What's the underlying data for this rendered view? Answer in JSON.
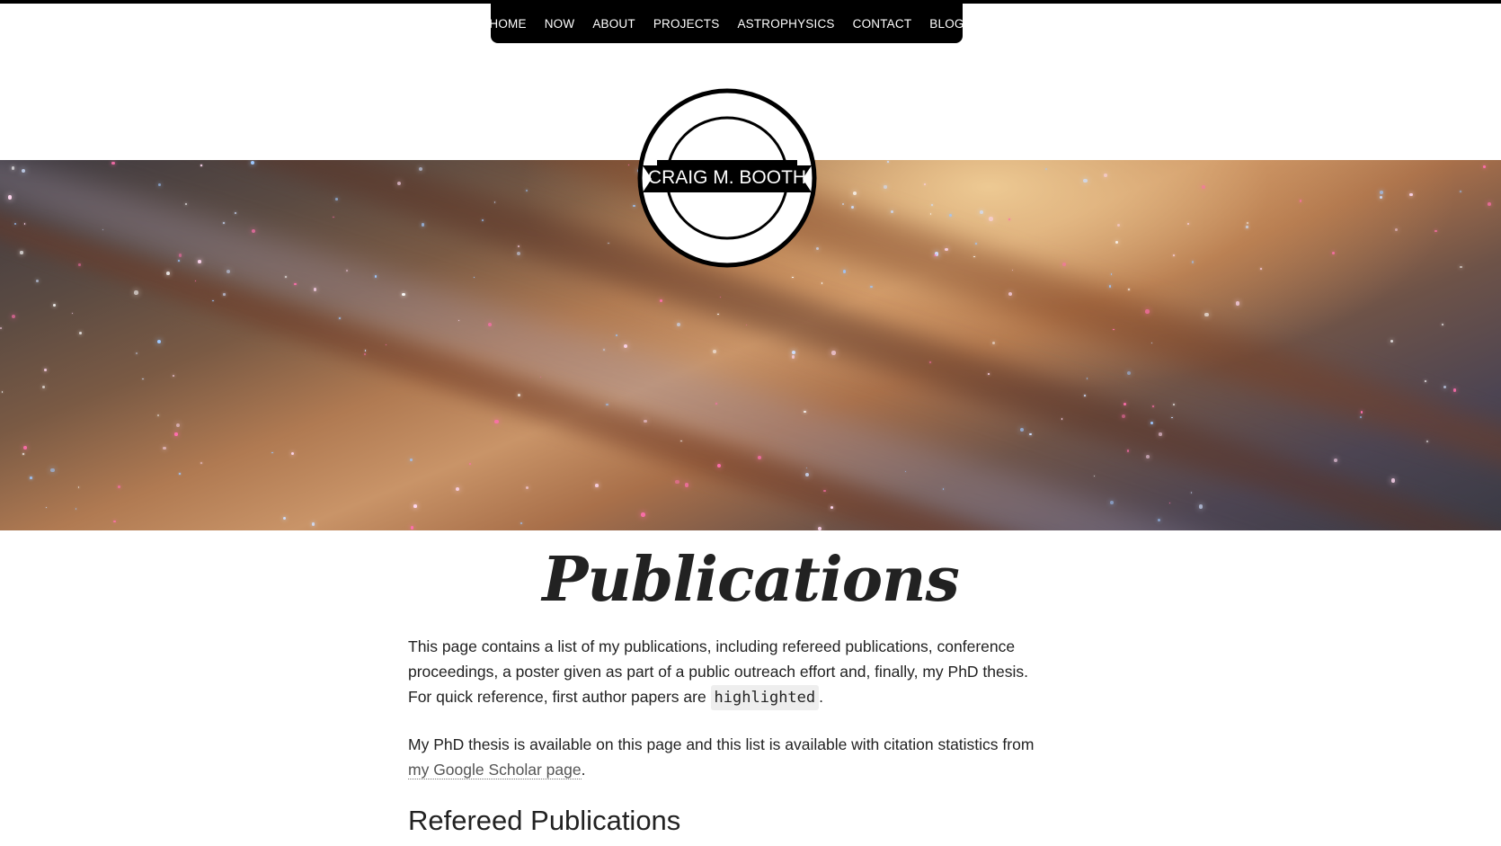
{
  "nav": {
    "items": [
      {
        "label": "HOME"
      },
      {
        "label": "NOW"
      },
      {
        "label": "ABOUT"
      },
      {
        "label": "PROJECTS"
      },
      {
        "label": "ASTROPHYSICS"
      },
      {
        "label": "CONTACT"
      },
      {
        "label": "BLOG"
      }
    ]
  },
  "logo": {
    "text": "CRAIG M. BOOTH",
    "icon": "circular-ribbon-logo"
  },
  "hero": {
    "icon": "galaxy-banner-image"
  },
  "page": {
    "title": "Publications",
    "intro_text": "This page contains a list of my publications, including refereed publications, conference proceedings, a poster given as part of a public outreach effort and, finally, my PhD thesis. For quick reference, first author papers are ",
    "intro_code": "highlighted",
    "intro_end": ".",
    "scholar_text": "My PhD thesis is available on this page and this list is available with citation statistics from ",
    "scholar_link": "my Google Scholar page",
    "scholar_end": ".",
    "section_heading": "Refereed Publications"
  },
  "colors": {
    "nav_bg": "#000000",
    "text": "#222222",
    "link": "#555555",
    "code_bg": "#eeeeee"
  }
}
